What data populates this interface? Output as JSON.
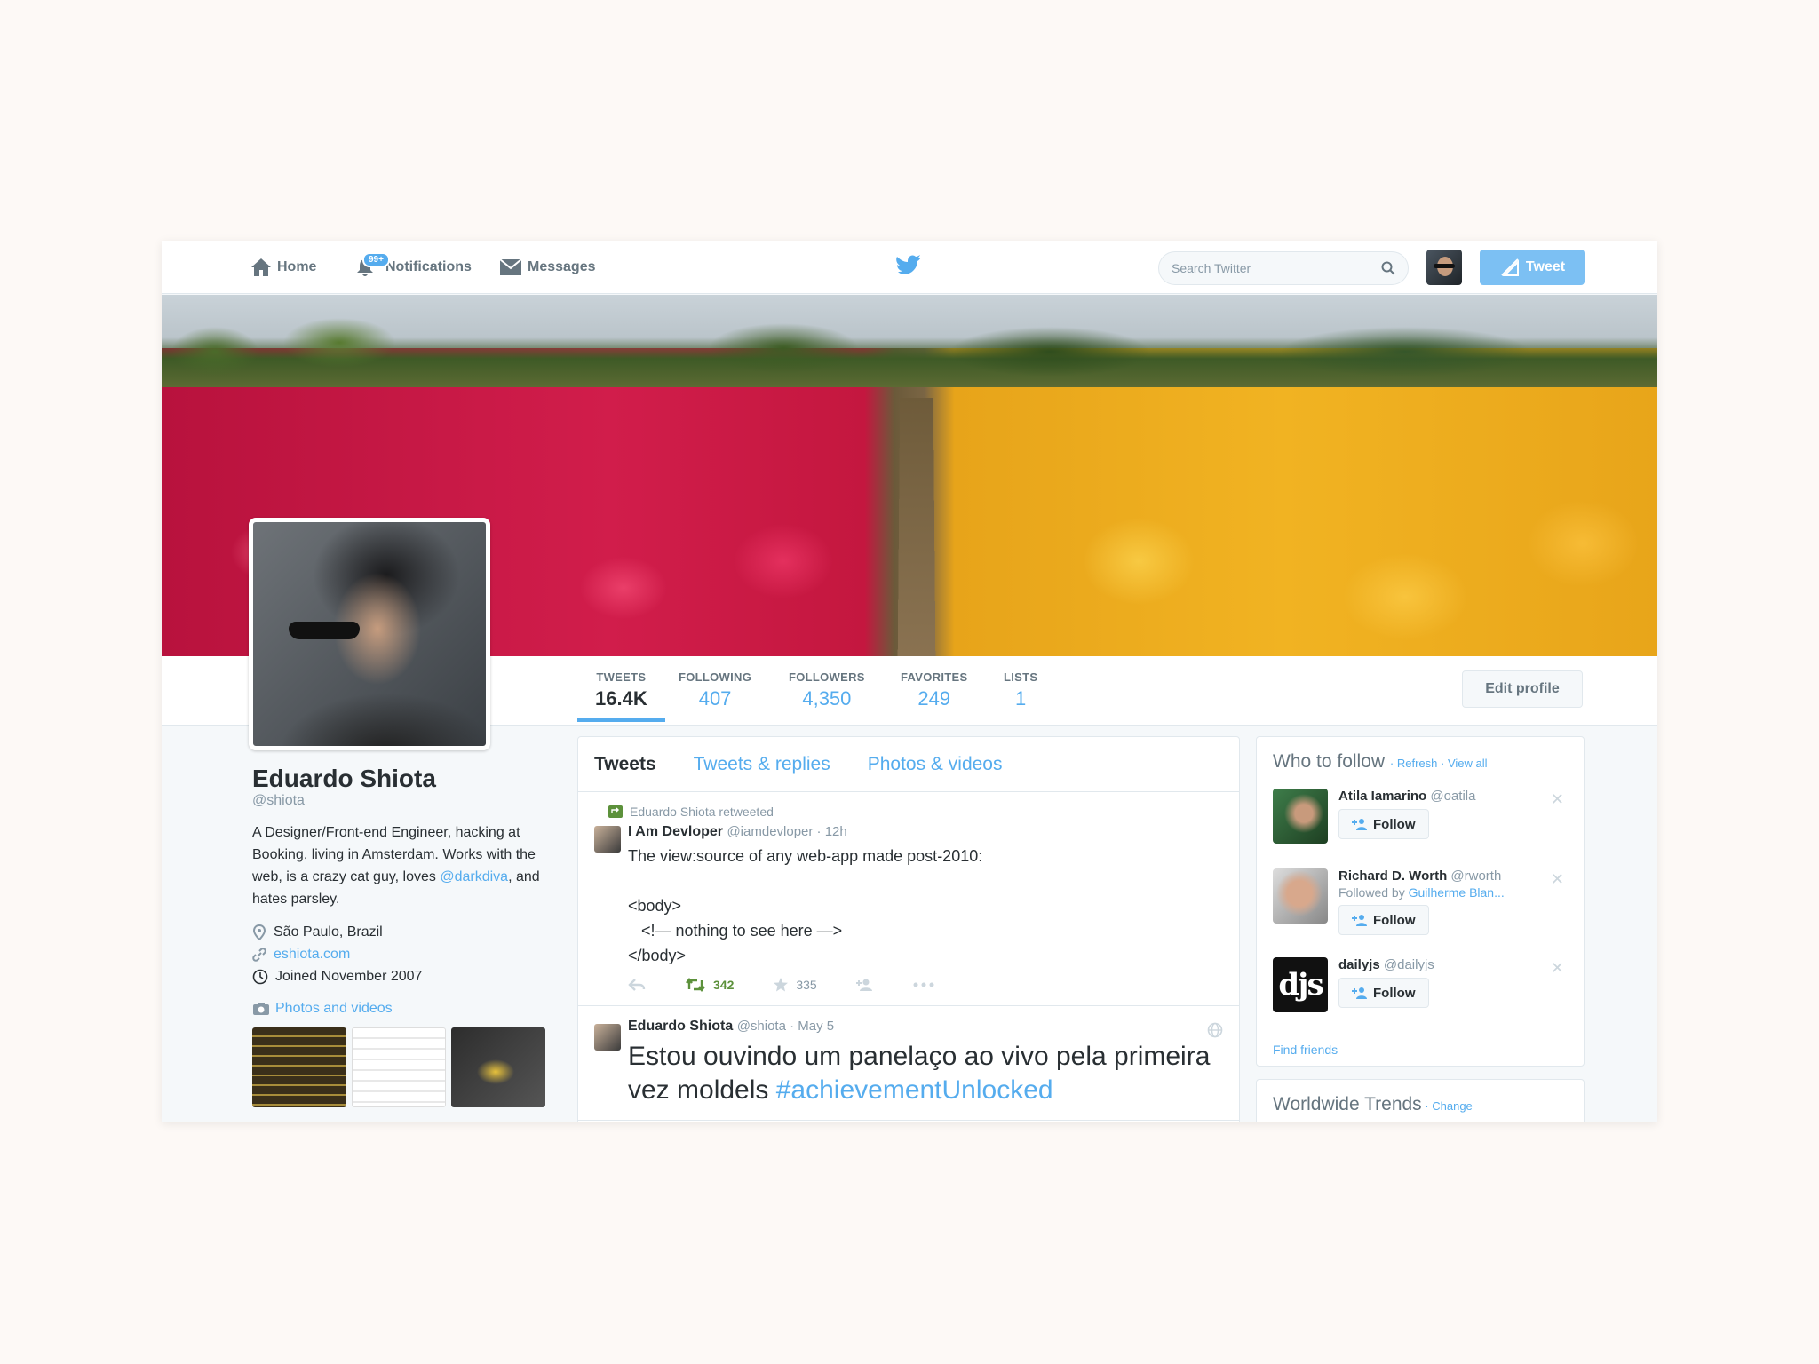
{
  "nav": {
    "home": "Home",
    "notifications": "Notifications",
    "notifications_badge": "99+",
    "messages": "Messages",
    "search_placeholder": "Search Twitter",
    "tweet_button": "Tweet"
  },
  "stats": [
    {
      "label": "TWEETS",
      "value": "16.4K"
    },
    {
      "label": "FOLLOWING",
      "value": "407"
    },
    {
      "label": "FOLLOWERS",
      "value": "4,350"
    },
    {
      "label": "FAVORITES",
      "value": "249"
    },
    {
      "label": "LISTS",
      "value": "1"
    }
  ],
  "edit_profile": "Edit profile",
  "profile": {
    "name": "Eduardo Shiota",
    "handle": "@shiota",
    "bio_text": "A Designer/Front-end Engineer, hacking at Booking, living in Amsterdam. Works with the web, is a crazy cat guy, loves ",
    "bio_mention": "@darkdiva",
    "bio_end": ", and hates parsley.",
    "location": "São Paulo, Brazil",
    "website": "eshiota.com",
    "joined": "Joined November 2007",
    "photos_link": "Photos and videos"
  },
  "tabs": [
    "Tweets",
    "Tweets & replies",
    "Photos & videos"
  ],
  "tweets": [
    {
      "retweet_note": "Eduardo Shiota retweeted",
      "author": "I Am Devloper",
      "meta": "@iamdevloper · 12h",
      "body": "The view:source of any web-app made post-2010:\n\n<body>\n   <!— nothing to see here —>\n</body>",
      "retweets": "342",
      "favorites": "335"
    },
    {
      "author": "Eduardo Shiota",
      "meta": "@shiota · May 5",
      "body": "Estou ouvindo um panelaço ao vivo pela primeira vez moldels ",
      "hashtag": "#achievementUnlocked"
    }
  ],
  "who_to_follow": {
    "title": "Who to follow",
    "refresh": "Refresh",
    "view_all": "View all",
    "follow_label": "Follow",
    "users": [
      {
        "name": "Atila Iamarino",
        "handle": "@oatila",
        "via": ""
      },
      {
        "name": "Richard D. Worth",
        "handle": "@rworth",
        "via_prefix": "Followed by ",
        "via": "Guilherme Blan..."
      },
      {
        "name": "dailyjs",
        "handle": "@dailyjs",
        "via": "",
        "avatar_text": "djs"
      }
    ],
    "find_friends": "Find friends"
  },
  "trends": {
    "title": "Worldwide Trends",
    "change": "Change"
  },
  "colors": {
    "accent": "#55acee",
    "retweet_green": "#5c913b"
  }
}
